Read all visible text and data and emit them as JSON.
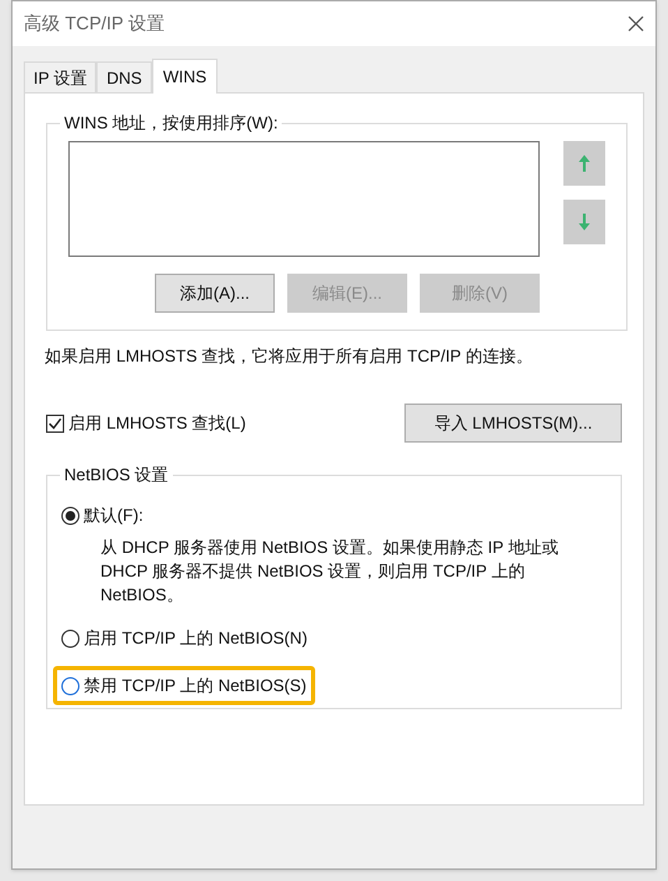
{
  "window": {
    "title": "高级 TCP/IP 设置"
  },
  "tabs": [
    {
      "label": "IP 设置",
      "selected": false
    },
    {
      "label": "DNS",
      "selected": false
    },
    {
      "label": "WINS",
      "selected": true
    }
  ],
  "wins_group": {
    "title": "WINS 地址，按使用排序(W):",
    "buttons": [
      {
        "label": "添加(A)...",
        "disabled": false
      },
      {
        "label": "编辑(E)...",
        "disabled": true
      },
      {
        "label": "删除(V)",
        "disabled": true
      }
    ]
  },
  "lmhosts_note": "如果启用 LMHOSTS 查找，它将应用于所有启用 TCP/IP 的连接。",
  "lmhosts_checkbox": {
    "label": "启用 LMHOSTS 查找(L)",
    "checked": true
  },
  "import_button": "导入 LMHOSTS(M)...",
  "netbios_group": {
    "title": "NetBIOS 设置",
    "options": [
      {
        "label": "默认(F):",
        "selected": true,
        "highlighted": false,
        "description": "从 DHCP 服务器使用 NetBIOS 设置。如果使用静态 IP 地址或 DHCP 服务器不提供 NetBIOS 设置，则启用 TCP/IP 上的 NetBIOS。"
      },
      {
        "label": "启用 TCP/IP 上的 NetBIOS(N)",
        "selected": false,
        "highlighted": false
      },
      {
        "label": "禁用 TCP/IP 上的 NetBIOS(S)",
        "selected": false,
        "highlighted": true
      }
    ]
  }
}
